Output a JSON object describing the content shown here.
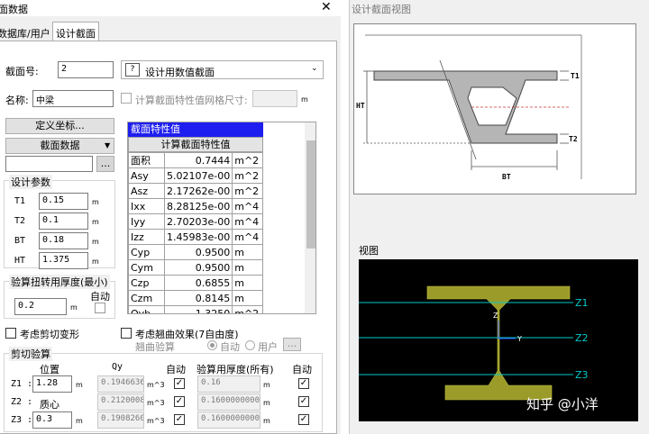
{
  "left_panel": {
    "window_title": "面数据",
    "tabs": [
      "数据库/用户",
      "设计截面"
    ],
    "section_no_label": "截面号:",
    "section_no_value": "2",
    "section_type_value": "设计用数值截面",
    "name_label": "名称:",
    "name_value": "中梁",
    "calc_grid_label": "计算截面特性值网格尺寸:",
    "calc_grid_unit": "m",
    "define_coords_button": "定义坐标...",
    "section_data_dropdown": "截面数据",
    "browse_button": "...",
    "design_params_title": "设计参数",
    "params": [
      {
        "label": "T1",
        "value": "0.15",
        "unit": "m"
      },
      {
        "label": "T2",
        "value": "0.1",
        "unit": "m"
      },
      {
        "label": "BT",
        "value": "0.18",
        "unit": "m"
      },
      {
        "label": "HT",
        "value": "1.375",
        "unit": "m"
      }
    ],
    "torsion_title": "验算扭转用厚度(最小)",
    "torsion_auto_label": "自动",
    "torsion_value": "0.2",
    "torsion_unit": "m",
    "shear_deform_label": "考虑剪切变形",
    "warping_label": "考虑翘曲效果(7自由度)",
    "warping_check_label": "翘曲验算",
    "radio_auto": "自动",
    "radio_user": "用户",
    "shear_check_title": "剪切验算",
    "shear_headers": {
      "position": "位置",
      "qy": "Qy",
      "auto": "自动",
      "thickness": "验算用厚度(所有)",
      "auto2": "自动"
    },
    "shear_rows": [
      {
        "label": "Z1 :",
        "position": "1.28",
        "pos_unit": "m",
        "qy": "0.1946636",
        "qy_unit": "m^3",
        "thickness": "0.16",
        "th_unit": "m"
      },
      {
        "label": "Z2 :",
        "position": "质心",
        "pos_unit": "",
        "qy": "0.2120008",
        "qy_unit": "m^3",
        "thickness": "0.1600000000",
        "th_unit": "m"
      },
      {
        "label": "Z3 :",
        "position": "0.3",
        "pos_unit": "m",
        "qy": "0.1908260",
        "qy_unit": "m^3",
        "thickness": "0.1600000000",
        "th_unit": "m"
      }
    ],
    "properties": {
      "title": "截面特性值",
      "subtitle": "计算截面特性值",
      "rows": [
        {
          "name": "面积",
          "value": "0.7444",
          "unit": "m^2"
        },
        {
          "name": "Asy",
          "value": "5.02107e-00",
          "unit": "m^2"
        },
        {
          "name": "Asz",
          "value": "2.17262e-00",
          "unit": "m^2"
        },
        {
          "name": "Ixx",
          "value": "8.28125e-00",
          "unit": "m^4"
        },
        {
          "name": "Iyy",
          "value": "2.70203e-00",
          "unit": "m^4"
        },
        {
          "name": "Izz",
          "value": "1.45983e-00",
          "unit": "m^4"
        },
        {
          "name": "Cyp",
          "value": "0.9500",
          "unit": "m"
        },
        {
          "name": "Cym",
          "value": "0.9500",
          "unit": "m"
        },
        {
          "name": "Czp",
          "value": "0.6855",
          "unit": "m"
        },
        {
          "name": "Czm",
          "value": "0.8145",
          "unit": "m"
        },
        {
          "name": "Qyb",
          "value": "1.3250",
          "unit": "m^2"
        }
      ]
    }
  },
  "right_panel": {
    "title": "设计截面视图",
    "diagram_labels": {
      "t1": "T1",
      "t2": "T2",
      "ht": "HT",
      "bt": "BT"
    },
    "view_label": "视图",
    "view_labels": {
      "z1": "Z1",
      "z2": "Z2",
      "z3": "Z3",
      "z_axis": "Z",
      "y_axis": "Y"
    },
    "watermark": "知乎 @小洋"
  },
  "colors": {
    "title_bar": "#1e1ef0",
    "beam_fill": "#9b9b2a",
    "view_bg": "#000000",
    "cyan": "#00c8c8"
  }
}
